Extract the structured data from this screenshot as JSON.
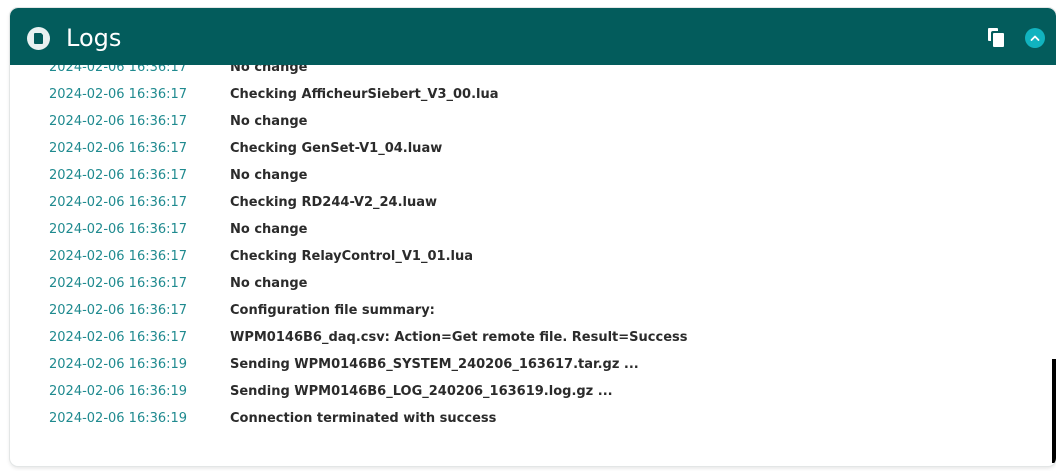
{
  "panel": {
    "title": "Logs",
    "icon": "log-document-icon",
    "actions": {
      "copy_icon": "copy-icon",
      "collapse_icon": "chevron-up-icon"
    },
    "colors": {
      "header_bg": "#035c5c",
      "timestamp": "#1f8a8f",
      "collapse_button": "#11b3bf"
    }
  },
  "logs": [
    {
      "time": "2024-02-06 16:36:17",
      "message": "No change"
    },
    {
      "time": "2024-02-06 16:36:17",
      "message": "Checking AfficheurSiebert_V3_00.lua"
    },
    {
      "time": "2024-02-06 16:36:17",
      "message": "No change"
    },
    {
      "time": "2024-02-06 16:36:17",
      "message": "Checking GenSet-V1_04.luaw"
    },
    {
      "time": "2024-02-06 16:36:17",
      "message": "No change"
    },
    {
      "time": "2024-02-06 16:36:17",
      "message": "Checking RD244-V2_24.luaw"
    },
    {
      "time": "2024-02-06 16:36:17",
      "message": "No change"
    },
    {
      "time": "2024-02-06 16:36:17",
      "message": "Checking RelayControl_V1_01.lua"
    },
    {
      "time": "2024-02-06 16:36:17",
      "message": "No change"
    },
    {
      "time": "2024-02-06 16:36:17",
      "message": "Configuration file summary:"
    },
    {
      "time": "2024-02-06 16:36:17",
      "message": "WPM0146B6_daq.csv: Action=Get remote file. Result=Success"
    },
    {
      "time": "2024-02-06 16:36:19",
      "message": "Sending WPM0146B6_SYSTEM_240206_163617.tar.gz ..."
    },
    {
      "time": "2024-02-06 16:36:19",
      "message": "Sending WPM0146B6_LOG_240206_163619.log.gz ..."
    },
    {
      "time": "2024-02-06 16:36:19",
      "message": "Connection terminated with success"
    }
  ]
}
